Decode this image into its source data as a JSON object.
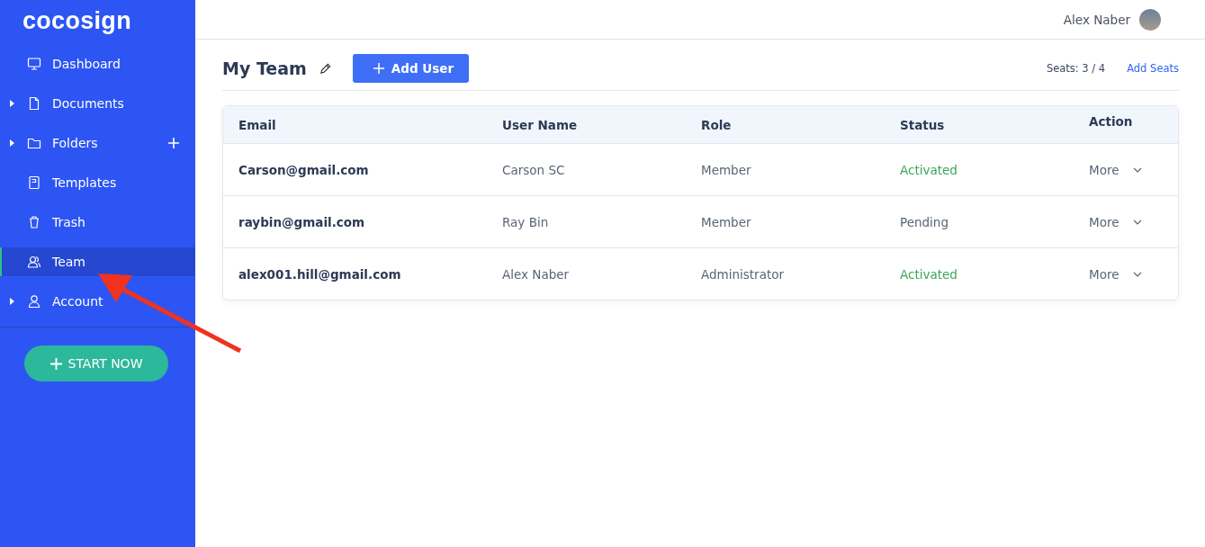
{
  "sidebar": {
    "logo": "cocosign",
    "items": [
      {
        "label": "Dashboard",
        "expandable": false,
        "add_button": false,
        "selected": false
      },
      {
        "label": "Documents",
        "expandable": true,
        "add_button": false,
        "selected": false
      },
      {
        "label": "Folders",
        "expandable": true,
        "add_button": true,
        "selected": false
      },
      {
        "label": "Templates",
        "expandable": false,
        "add_button": false,
        "selected": false
      },
      {
        "label": "Trash",
        "expandable": false,
        "add_button": false,
        "selected": false
      },
      {
        "label": "Team",
        "expandable": false,
        "add_button": false,
        "selected": true
      },
      {
        "label": "Account",
        "expandable": true,
        "add_button": false,
        "selected": false
      }
    ],
    "start_button": "START NOW"
  },
  "header": {
    "user_name": "Alex Naber"
  },
  "page": {
    "title": "My Team",
    "add_user_button": "Add User",
    "seats": "Seats: 3 / 4",
    "add_seats_link": "Add Seats"
  },
  "table": {
    "columns": [
      "Email",
      "User Name",
      "Role",
      "Status",
      "Action"
    ],
    "rows": [
      {
        "email": "Carson@gmail.com",
        "user_name": "Carson SC",
        "role": "Member",
        "status": "Activated",
        "color": "#3aa757",
        "action": "More"
      },
      {
        "email": "raybin@gmail.com",
        "user_name": "Ray Bin",
        "role": "Member",
        "status": "Pending",
        "color": "#5a6478",
        "action": "More"
      },
      {
        "email": "alex001.hill@gmail.com",
        "user_name": "Alex Naber",
        "role": "Administrator",
        "status": "Activated",
        "color": "#3aa757",
        "action": "More"
      }
    ]
  }
}
